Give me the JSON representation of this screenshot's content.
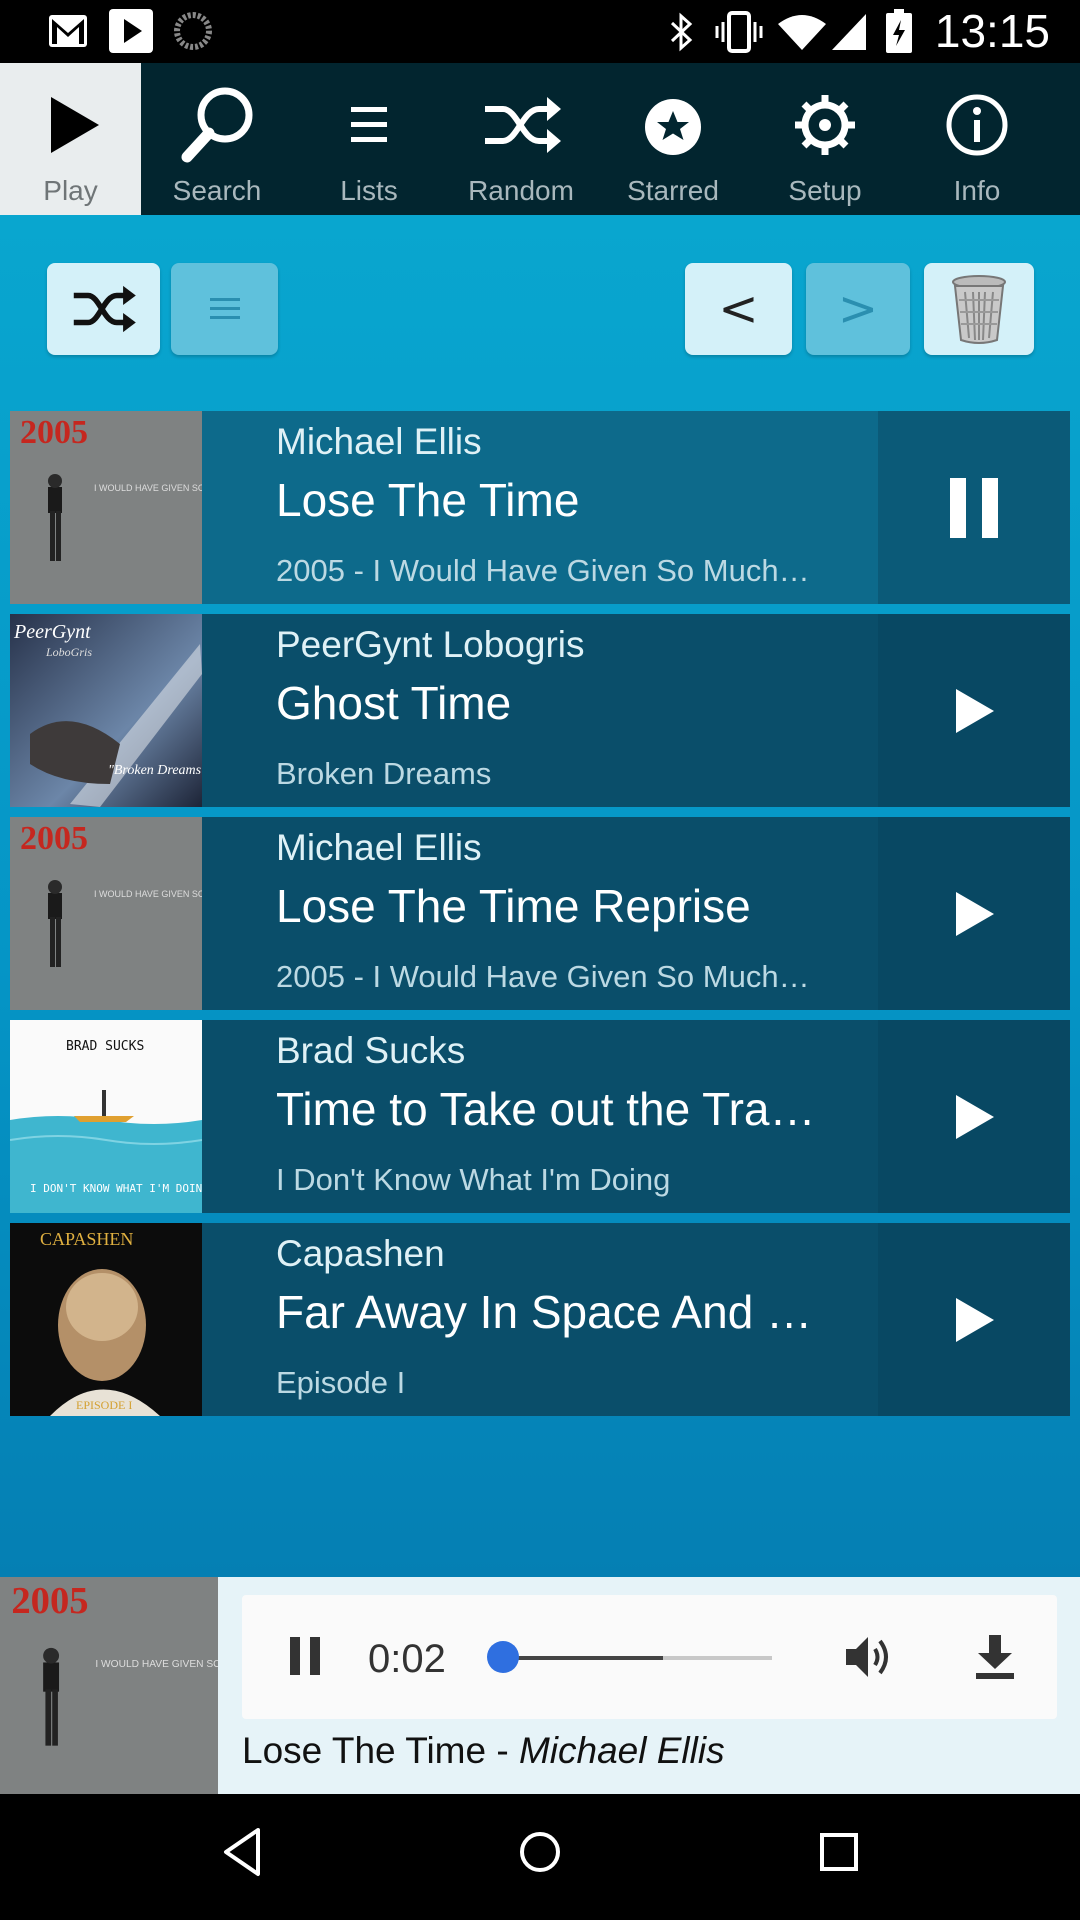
{
  "status_bar": {
    "time": "13:15",
    "left_icons": [
      "gmail-icon",
      "youtube-icon",
      "sync-icon"
    ],
    "right_icons": [
      "bluetooth-icon",
      "vibrate-icon",
      "wifi-icon",
      "signal-icon",
      "battery-icon"
    ]
  },
  "nav": {
    "items": [
      {
        "label": "Play",
        "icon": "play-icon",
        "active": true
      },
      {
        "label": "Search",
        "icon": "search-icon"
      },
      {
        "label": "Lists",
        "icon": "list-icon"
      },
      {
        "label": "Random",
        "icon": "shuffle-icon"
      },
      {
        "label": "Starred",
        "icon": "star-icon"
      },
      {
        "label": "Setup",
        "icon": "gear-icon"
      },
      {
        "label": "Info",
        "icon": "info-icon"
      }
    ]
  },
  "toolbar": {
    "prev_label": "<",
    "next_label": ">"
  },
  "tracks": [
    {
      "artist": "Michael Ellis",
      "title": "Lose The Time",
      "album": "2005 - I Would Have Given So Much…",
      "state": "playing"
    },
    {
      "artist": "PeerGynt Lobogris",
      "title": "Ghost Time",
      "album": "Broken Dreams",
      "state": "idle"
    },
    {
      "artist": "Michael Ellis",
      "title": "Lose The Time Reprise",
      "album": "2005 - I Would Have Given So Much…",
      "state": "idle"
    },
    {
      "artist": "Brad Sucks",
      "title": "Time to Take out the Tra…",
      "album": "I Don't Know What I'm Doing",
      "state": "idle"
    },
    {
      "artist": "Capashen",
      "title": "Far Away In Space And …",
      "album": "Episode I",
      "state": "idle"
    }
  ],
  "album_art_text": {
    "a2005": "2005",
    "a2005_sub": "I WOULD HAVE GIVEN SO MUCH MORE",
    "peergynt": "PeerGynt",
    "peergynt_sub": "LoboGris",
    "peergynt_album": "\"Broken Dreams\"",
    "brad": "BRAD SUCKS",
    "brad_sub": "I DON'T KNOW WHAT I'M DOING",
    "capashen": "CAPASHEN",
    "capashen_sub": "EPISODE I"
  },
  "player": {
    "time": "0:02",
    "progress": 0.01,
    "buffered": 0.6,
    "now_title": "Lose The Time",
    "separator": " - ",
    "now_artist": "Michael Ellis"
  }
}
